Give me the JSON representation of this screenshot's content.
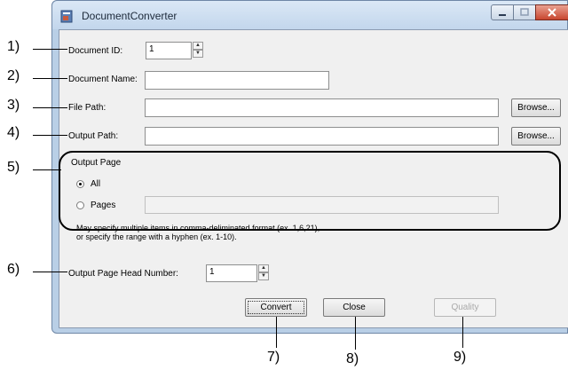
{
  "window": {
    "title": "DocumentConverter",
    "icon": "document-converter-icon"
  },
  "form": {
    "document_id_label": "Document ID:",
    "document_id_value": "1",
    "document_name_label": "Document Name:",
    "document_name_value": "",
    "file_path_label": "File Path:",
    "file_path_value": "",
    "file_browse_label": "Browse...",
    "output_path_label": "Output Path:",
    "output_path_value": "",
    "output_browse_label": "Browse...",
    "output_page_group": "Output Page",
    "radio_all_label": "All",
    "radio_pages_label": "Pages",
    "pages_value": "",
    "selected_radio": "All",
    "note_line1": "May specify multiple items in comma-deliminated format (ex. 1,6,21),",
    "note_line2": "or specify the range with a hyphen (ex. 1-10).",
    "head_number_label": "Output Page Head Number:",
    "head_number_value": "1"
  },
  "buttons": {
    "convert": "Convert",
    "close": "Close",
    "quality": "Quality"
  },
  "callouts": [
    "1)",
    "2)",
    "3)",
    "4)",
    "5)",
    "6)",
    "7)",
    "8)",
    "9)"
  ]
}
